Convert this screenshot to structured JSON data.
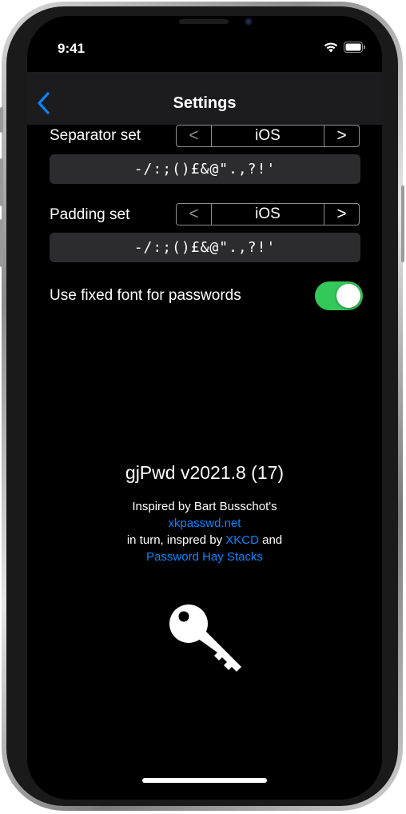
{
  "status_bar": {
    "time": "9:41"
  },
  "navbar": {
    "title": "Settings"
  },
  "separator": {
    "label": "Separator set",
    "prev": "<",
    "value": "iOS",
    "next": ">",
    "chars": "-/:;()£&@\".,?!'"
  },
  "padding": {
    "label": "Padding set",
    "prev": "<",
    "value": "iOS",
    "next": ">",
    "chars": "-/:;()£&@\".,?!'"
  },
  "fixed_font": {
    "label": "Use fixed font for passwords",
    "enabled": true
  },
  "about": {
    "version": "gjPwd v2021.8 (17)",
    "inspired_by": "Inspired by Bart Busschot's",
    "link_xkpasswd": "xkpasswd.net",
    "in_turn_prefix": "in turn, inspred by ",
    "link_xkcd": "XKCD",
    "in_turn_suffix": " and",
    "link_haystacks": "Password Hay Stacks"
  },
  "colors": {
    "accent": "#0a84ff",
    "toggle_on": "#34c759",
    "navbar_bg": "#1c1c1e",
    "field_bg": "#2c2c2e"
  },
  "icons": {
    "back": "chevron-left-icon",
    "wifi": "wifi-icon",
    "battery": "battery-icon",
    "key": "key-icon"
  }
}
